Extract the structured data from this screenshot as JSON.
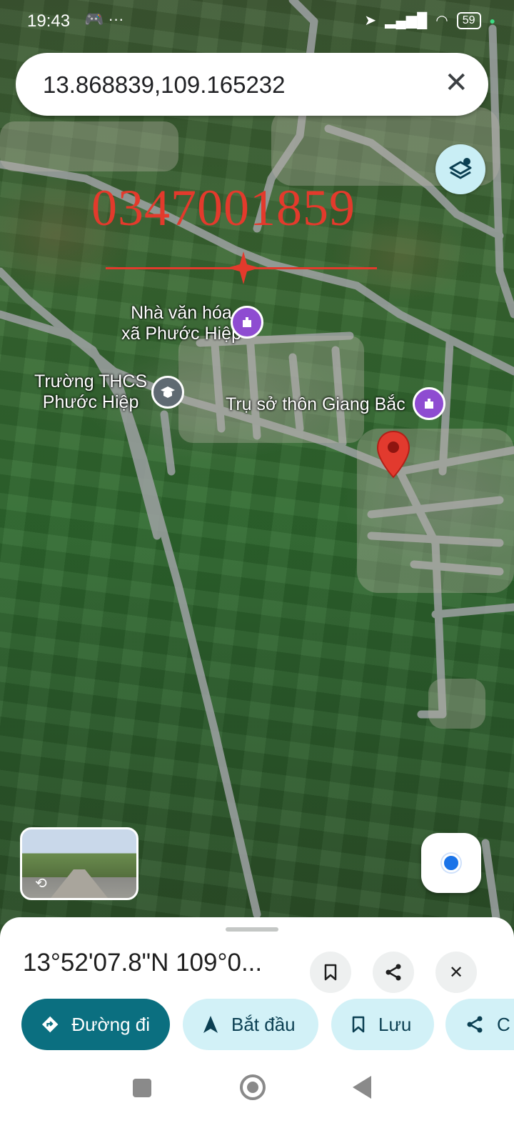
{
  "status_bar": {
    "time": "19:43",
    "notifications": "🎮 ···",
    "battery": "59"
  },
  "search": {
    "query": "13.868839,109.165232"
  },
  "overlay": {
    "phone_number": "0347001859"
  },
  "places": [
    {
      "name": "Nhà văn hóa\nxã Phước Hiệp",
      "icon": "landmark-icon"
    },
    {
      "name": "Trường THCS\nPhước Hiệp",
      "icon": "school-icon"
    },
    {
      "name": "Trụ sở thôn Giang Bắc",
      "icon": "landmark-icon"
    }
  ],
  "sheet": {
    "coords": "13°52'07.8\"N 109°0...",
    "chips": [
      {
        "label": "Đường đi",
        "icon": "directions-icon"
      },
      {
        "label": "Bắt đầu",
        "icon": "navigate-icon"
      },
      {
        "label": "Lưu",
        "icon": "bookmark-icon"
      },
      {
        "label": "C",
        "icon": "share-icon"
      }
    ]
  },
  "colors": {
    "accent": "#0b6f80",
    "chip": "#d2f1f7",
    "pin": "#e23a2e",
    "overlay_red": "#e33a2c",
    "poi": "#8e4cd1"
  }
}
